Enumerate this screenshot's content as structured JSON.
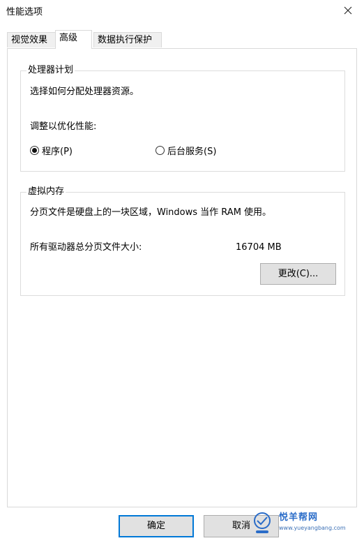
{
  "window": {
    "title": "性能选项"
  },
  "tabs": [
    {
      "label": "视觉效果"
    },
    {
      "label": "高级"
    },
    {
      "label": "数据执行保护"
    }
  ],
  "cpu_group": {
    "title": "处理器计划",
    "description": "选择如何分配处理器资源。",
    "adjust_label": "调整以优化性能:",
    "options": [
      {
        "label": "程序(P)",
        "selected": true
      },
      {
        "label": "后台服务(S)",
        "selected": false
      }
    ]
  },
  "memory_group": {
    "title": "虚拟内存",
    "description": "分页文件是硬盘上的一块区域，Windows 当作 RAM 使用。",
    "total_label": "所有驱动器总分页文件大小:",
    "total_value": "16704 MB",
    "change_button": "更改(C)..."
  },
  "footer": {
    "ok_button": "确定",
    "cancel_button": "取消"
  },
  "watermark": {
    "text": "悦羊帮网",
    "url": "www.yueyangbang.com"
  },
  "colors": {
    "accent": "#0078d7",
    "border": "#d9d9d9",
    "button_bg": "#e1e1e1"
  }
}
